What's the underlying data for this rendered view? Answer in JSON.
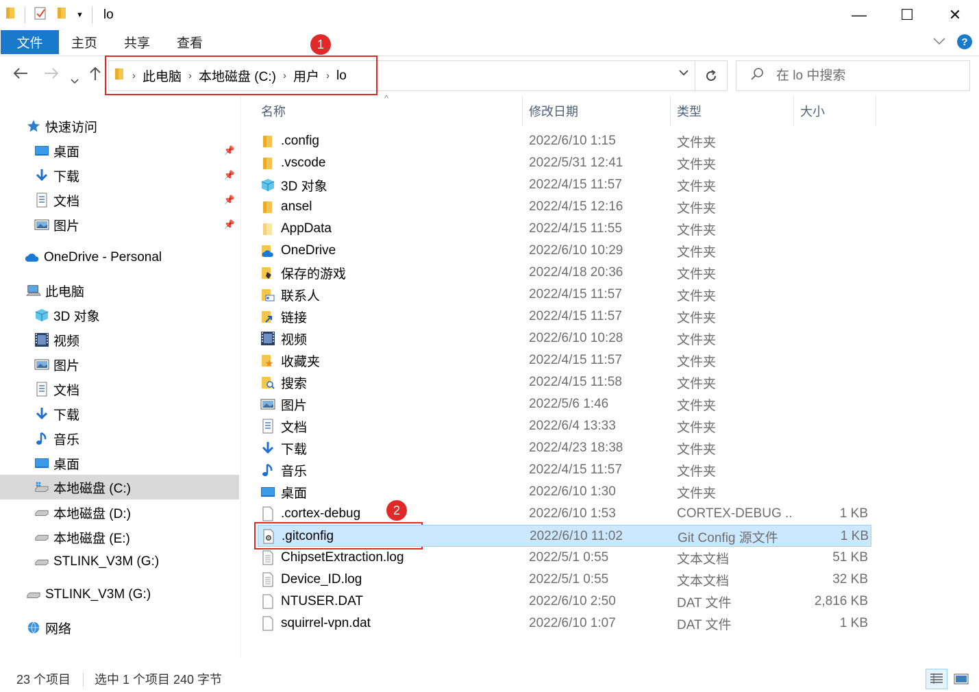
{
  "window": {
    "title": "lo",
    "controls": {
      "minimize": "—",
      "maximize": "☐",
      "close": "✕"
    }
  },
  "ribbon": {
    "tabs": [
      {
        "label": "文件",
        "active": true
      },
      {
        "label": "主页"
      },
      {
        "label": "共享"
      },
      {
        "label": "查看"
      }
    ]
  },
  "address": {
    "breadcrumbs": [
      "此电脑",
      "本地磁盘 (C:)",
      "用户",
      "lo"
    ],
    "search_placeholder": "在 lo 中搜索"
  },
  "annotations": [
    {
      "label": "1"
    },
    {
      "label": "2"
    }
  ],
  "nav": {
    "quick_access": "快速访问",
    "quick_items": [
      {
        "label": "桌面",
        "icon": "desktop-icon"
      },
      {
        "label": "下载",
        "icon": "download-icon"
      },
      {
        "label": "文档",
        "icon": "document-icon"
      },
      {
        "label": "图片",
        "icon": "picture-icon"
      }
    ],
    "onedrive": "OneDrive - Personal",
    "this_pc": "此电脑",
    "pc_items": [
      {
        "label": "3D 对象",
        "icon": "3d-objects-icon"
      },
      {
        "label": "视频",
        "icon": "video-icon"
      },
      {
        "label": "图片",
        "icon": "picture-icon"
      },
      {
        "label": "文档",
        "icon": "document-icon"
      },
      {
        "label": "下载",
        "icon": "download-icon"
      },
      {
        "label": "音乐",
        "icon": "music-icon"
      },
      {
        "label": "桌面",
        "icon": "desktop-icon"
      },
      {
        "label": "本地磁盘 (C:)",
        "icon": "windows-drive-icon",
        "selected": true
      },
      {
        "label": "本地磁盘 (D:)",
        "icon": "drive-icon"
      },
      {
        "label": "本地磁盘 (E:)",
        "icon": "drive-icon"
      },
      {
        "label": "STLINK_V3M (G:)",
        "icon": "drive-icon"
      }
    ],
    "stlink": "STLINK_V3M (G:)",
    "network": "网络"
  },
  "columns": {
    "name": "名称",
    "date": "修改日期",
    "type": "类型",
    "size": "大小"
  },
  "files": [
    {
      "name": ".config",
      "date": "2022/6/10 1:15",
      "type": "文件夹",
      "size": "",
      "icon": "folder-icon"
    },
    {
      "name": ".vscode",
      "date": "2022/5/31 12:41",
      "type": "文件夹",
      "size": "",
      "icon": "folder-icon"
    },
    {
      "name": "3D 对象",
      "date": "2022/4/15 11:57",
      "type": "文件夹",
      "size": "",
      "icon": "3d-objects-icon"
    },
    {
      "name": "ansel",
      "date": "2022/4/15 12:16",
      "type": "文件夹",
      "size": "",
      "icon": "folder-icon"
    },
    {
      "name": "AppData",
      "date": "2022/4/15 11:55",
      "type": "文件夹",
      "size": "",
      "icon": "folder-faded-icon"
    },
    {
      "name": "OneDrive",
      "date": "2022/6/10 10:29",
      "type": "文件夹",
      "size": "",
      "icon": "onedrive-folder-icon"
    },
    {
      "name": "保存的游戏",
      "date": "2022/4/18 20:36",
      "type": "文件夹",
      "size": "",
      "icon": "saved-games-icon"
    },
    {
      "name": "联系人",
      "date": "2022/4/15 11:57",
      "type": "文件夹",
      "size": "",
      "icon": "contacts-icon"
    },
    {
      "name": "链接",
      "date": "2022/4/15 11:57",
      "type": "文件夹",
      "size": "",
      "icon": "links-icon"
    },
    {
      "name": "视频",
      "date": "2022/6/10 10:28",
      "type": "文件夹",
      "size": "",
      "icon": "video-icon"
    },
    {
      "name": "收藏夹",
      "date": "2022/4/15 11:57",
      "type": "文件夹",
      "size": "",
      "icon": "favorites-icon"
    },
    {
      "name": "搜索",
      "date": "2022/4/15 11:58",
      "type": "文件夹",
      "size": "",
      "icon": "searches-icon"
    },
    {
      "name": "图片",
      "date": "2022/5/6 1:46",
      "type": "文件夹",
      "size": "",
      "icon": "picture-icon"
    },
    {
      "name": "文档",
      "date": "2022/6/4 13:33",
      "type": "文件夹",
      "size": "",
      "icon": "document-icon"
    },
    {
      "name": "下载",
      "date": "2022/4/23 18:38",
      "type": "文件夹",
      "size": "",
      "icon": "download-icon"
    },
    {
      "name": "音乐",
      "date": "2022/4/15 11:57",
      "type": "文件夹",
      "size": "",
      "icon": "music-icon"
    },
    {
      "name": "桌面",
      "date": "2022/6/10 1:30",
      "type": "文件夹",
      "size": "",
      "icon": "desktop-icon"
    },
    {
      "name": ".cortex-debug",
      "date": "2022/6/10 1:53",
      "type": "CORTEX-DEBUG ...",
      "size": "1 KB",
      "icon": "file-icon"
    },
    {
      "name": ".gitconfig",
      "date": "2022/6/10 11:02",
      "type": "Git Config 源文件",
      "size": "1 KB",
      "icon": "config-file-icon",
      "selected": true
    },
    {
      "name": "ChipsetExtraction.log",
      "date": "2022/5/1 0:55",
      "type": "文本文档",
      "size": "51 KB",
      "icon": "text-file-icon"
    },
    {
      "name": "Device_ID.log",
      "date": "2022/5/1 0:55",
      "type": "文本文档",
      "size": "32 KB",
      "icon": "text-file-icon"
    },
    {
      "name": "NTUSER.DAT",
      "date": "2022/6/10 2:50",
      "type": "DAT 文件",
      "size": "2,816 KB",
      "icon": "file-icon"
    },
    {
      "name": "squirrel-vpn.dat",
      "date": "2022/6/10 1:07",
      "type": "DAT 文件",
      "size": "1 KB",
      "icon": "file-icon"
    }
  ],
  "status": {
    "count": "23 个项目",
    "selection": "选中 1 个项目  240 字节"
  },
  "colors": {
    "accent": "#1979ca",
    "annotation": "#e02a2a",
    "selection": "#cce8ff",
    "folder": "#f5c54e"
  }
}
